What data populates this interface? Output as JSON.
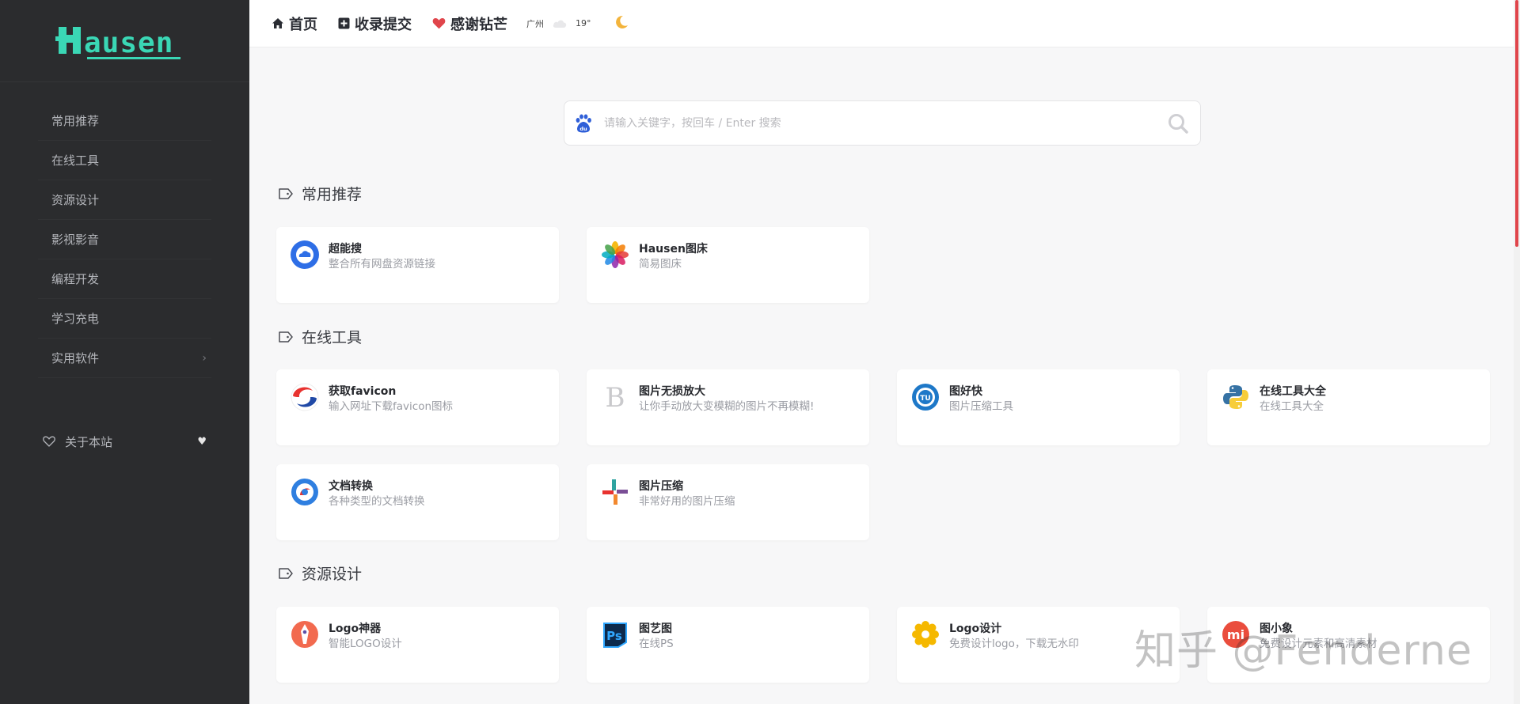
{
  "sidebar": {
    "logo_text": "Hausen",
    "items": [
      {
        "label": "常用推荐"
      },
      {
        "label": "在线工具"
      },
      {
        "label": "资源设计"
      },
      {
        "label": "影视影音"
      },
      {
        "label": "编程开发"
      },
      {
        "label": "学习充电"
      },
      {
        "label": "实用软件",
        "has_submenu": true
      }
    ],
    "about": {
      "label": "关于本站"
    }
  },
  "header": {
    "links": [
      {
        "label": "首页",
        "icon": "home-icon"
      },
      {
        "label": "收录提交",
        "icon": "plus-square-icon"
      },
      {
        "label": "感谢钻芒",
        "icon": "heart-icon"
      }
    ],
    "weather": {
      "city": "广州",
      "temp": "19°",
      "icon": "cloud-icon"
    },
    "theme_icon": "moon-icon"
  },
  "search": {
    "placeholder": "请输入关键字，按回车 / Enter 搜索",
    "engine_icon": "baidu-icon"
  },
  "sections": [
    {
      "title": "常用推荐",
      "cards": [
        {
          "title": "超能搜",
          "desc": "整合所有网盘资源链接",
          "icon": "cloud-search-icon"
        },
        {
          "title": "Hausen图床",
          "desc": "简易图床",
          "icon": "photos-flower-icon"
        }
      ]
    },
    {
      "title": "在线工具",
      "cards": [
        {
          "title": "获取favicon",
          "desc": "输入网址下载favicon图标",
          "icon": "favicon-swirl-icon"
        },
        {
          "title": "图片无损放大",
          "desc": "让你手动放大变模糊的图片不再模糊!",
          "icon": "letter-b-icon"
        },
        {
          "title": "图好快",
          "desc": "图片压缩工具",
          "icon": "tuhaokuai-icon"
        },
        {
          "title": "在线工具大全",
          "desc": "在线工具大全",
          "icon": "python-icon"
        },
        {
          "title": "文档转换",
          "desc": "各种类型的文档转换",
          "icon": "doc-convert-icon"
        },
        {
          "title": "图片压缩",
          "desc": "非常好用的图片压缩",
          "icon": "compress-cross-icon"
        }
      ]
    },
    {
      "title": "资源设计",
      "cards": [
        {
          "title": "Logo神器",
          "desc": "智能LOGO设计",
          "icon": "logo-pen-icon"
        },
        {
          "title": "图艺图",
          "desc": "在线PS",
          "icon": "ps-icon"
        },
        {
          "title": "Logo设计",
          "desc": "免费设计logo，下载无水印",
          "icon": "gear-flower-icon"
        },
        {
          "title": "图小象",
          "desc": "免费设计元素和高清素材",
          "icon": "mi-icon"
        }
      ]
    }
  ],
  "watermark": "知乎 @Fenderne",
  "colors": {
    "sidebar_bg": "#2b2c2e",
    "accent": "#3ad7b5",
    "heart": "#e0454b",
    "page_bg": "#f7f7f8"
  }
}
